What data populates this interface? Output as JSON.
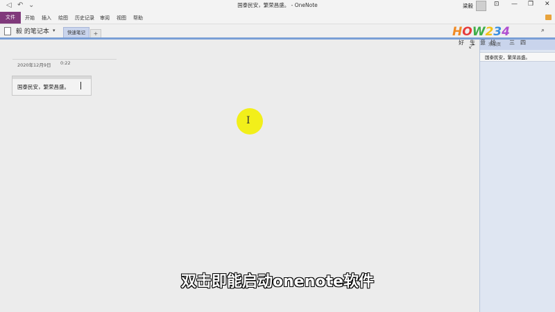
{
  "window": {
    "title": "国泰民安，繁荣昌盛。 - OneNote",
    "user_name": "梁毅",
    "quick_access": {
      "back": "◁",
      "undo": "↶",
      "more": "⌄"
    },
    "controls": {
      "ribbon_display": "⊡",
      "minimize": "—",
      "restore": "❐",
      "close": "✕"
    }
  },
  "ribbon": {
    "file_label": "文件",
    "tabs": [
      "开始",
      "插入",
      "绘图",
      "历史记录",
      "审阅",
      "视图",
      "帮助"
    ]
  },
  "notebook": {
    "name": "毅 的笔记本",
    "dropdown": "▾",
    "section_tab": "快速笔记",
    "add_section": "+"
  },
  "logo": {
    "text": "HOW234"
  },
  "pane": {
    "search_icon": "⌕",
    "add_page_label": "添加页",
    "overlay_chars": [
      "好",
      "生",
      "意",
      "恰",
      "三",
      "四"
    ],
    "expand_icon": "⤢",
    "pages": [
      "国泰民安，繁荣昌盛。"
    ]
  },
  "page": {
    "date": "2020年12月9日",
    "time": "0:22",
    "note_text": "国泰民安，繁荣昌盛。"
  },
  "subtitle": "双击即能启动onenote软件",
  "colors": {
    "file_tab": "#80397b",
    "accent_blue": "#7a9fd6",
    "cursor_highlight": "#f2ef1a"
  }
}
